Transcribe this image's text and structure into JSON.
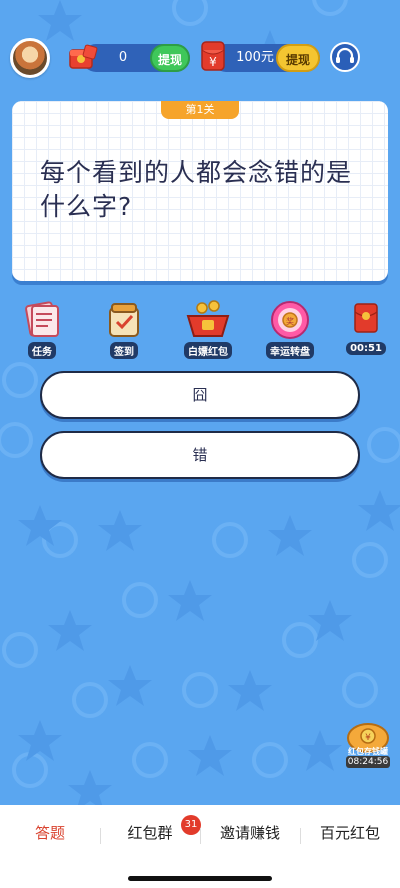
{
  "header": {
    "coins_value": "0",
    "withdraw_label_left": "提现",
    "cash_value": "100元",
    "withdraw_label_right": "提现"
  },
  "question": {
    "level": "第1关",
    "text": "每个看到的人都会念错的是什么字?"
  },
  "features": [
    {
      "label": "任务",
      "icon": "task-icon"
    },
    {
      "label": "签到",
      "icon": "checkin-icon"
    },
    {
      "label": "白嫖红包",
      "icon": "free-redpacket-icon"
    },
    {
      "label": "幸运转盘",
      "icon": "lucky-wheel-icon"
    }
  ],
  "timer_redpacket": {
    "time": "00:51",
    "icon": "red-envelope-icon"
  },
  "answers": [
    "囧",
    "错"
  ],
  "savings": {
    "label": "红包存钱罐",
    "time": "08:24:56"
  },
  "bottom_nav": {
    "items": [
      "答题",
      "红包群",
      "邀请赚钱",
      "百元红包"
    ],
    "active_index": 0,
    "badge_count": "31"
  },
  "colors": {
    "background": "#5aa6f0",
    "accent_active": "#d9432f",
    "green_button": "#3fc75a",
    "yellow_button": "#f4c531"
  }
}
